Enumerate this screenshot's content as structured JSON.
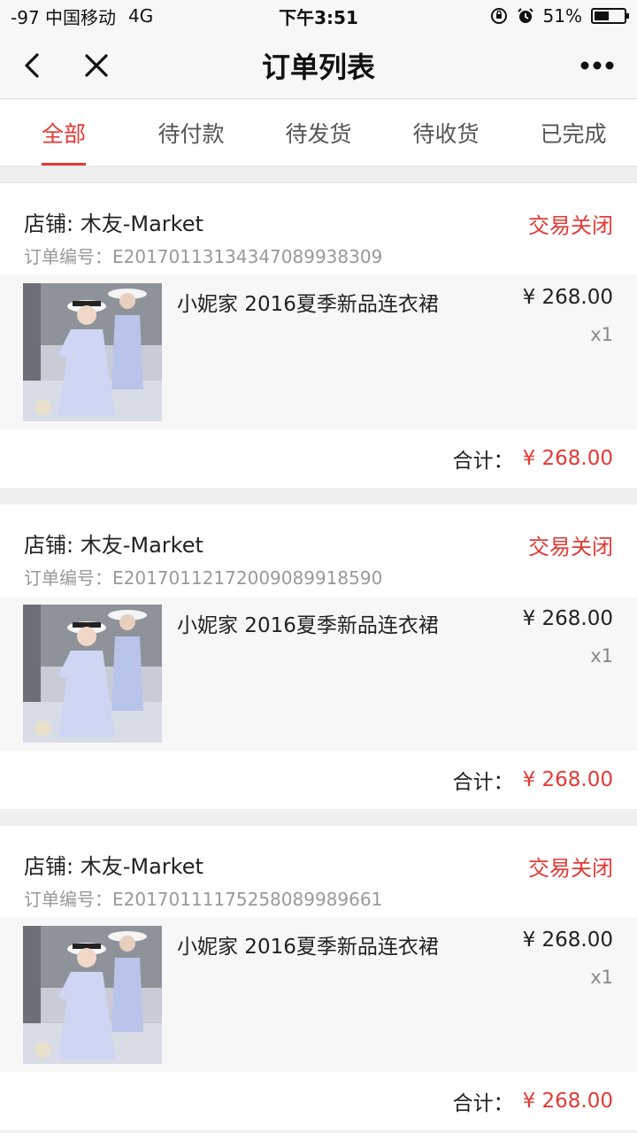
{
  "status_bar": {
    "carrier": "-97 中国移动",
    "network": "4G",
    "time": "下午3:51",
    "battery_text": "51%",
    "battery_level": 0.51
  },
  "nav": {
    "title": "订单列表",
    "back_icon": "chevron-left-icon",
    "close_icon": "close-icon",
    "more_icon": "more-dots-icon"
  },
  "tabs": [
    {
      "label": "全部",
      "active": true
    },
    {
      "label": "待付款",
      "active": false
    },
    {
      "label": "待发货",
      "active": false
    },
    {
      "label": "待收货",
      "active": false
    },
    {
      "label": "已完成",
      "active": false
    }
  ],
  "orders": [
    {
      "shop": "店铺: 木友-Market",
      "order_no": "订单编号：E20170113134347089938309",
      "status": "交易关闭",
      "item_name": "小妮家 2016夏季新品连衣裙",
      "price": "¥ 268.00",
      "qty": "x1",
      "total_label": "合计：",
      "total": "¥ 268.00"
    },
    {
      "shop": "店铺: 木友-Market",
      "order_no": "订单编号：E20170112172009089918590",
      "status": "交易关闭",
      "item_name": "小妮家 2016夏季新品连衣裙",
      "price": "¥ 268.00",
      "qty": "x1",
      "total_label": "合计：",
      "total": "¥ 268.00"
    },
    {
      "shop": "店铺: 木友-Market",
      "order_no": "订单编号：E20170111175258089989661",
      "status": "交易关闭",
      "item_name": "小妮家 2016夏季新品连衣裙",
      "price": "¥ 268.00",
      "qty": "x1",
      "total_label": "合计：",
      "total": "¥ 268.00"
    }
  ],
  "colors": {
    "accent": "#e53935",
    "secondary_text": "#999999"
  }
}
